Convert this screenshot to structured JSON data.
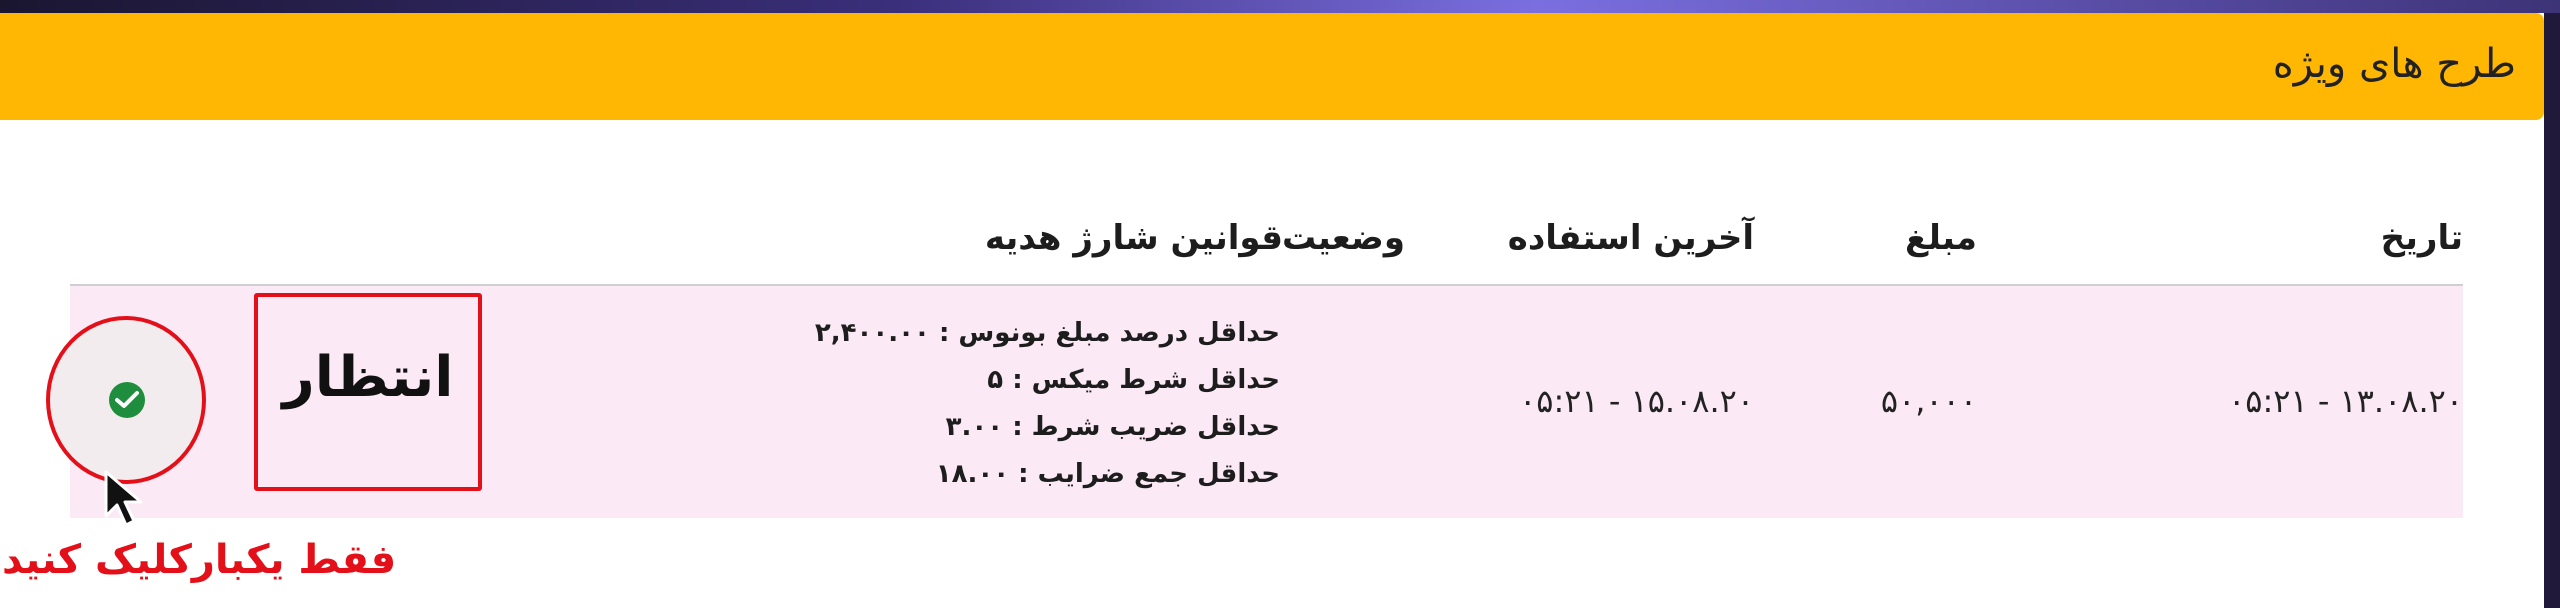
{
  "header": {
    "title": "طرح های ویژه"
  },
  "table": {
    "columns": {
      "date": "تاریخ",
      "amount": "مبلغ",
      "last_used": "آخرین استفاده",
      "rules": "قوانین شارژ هدیه",
      "status": "وضعیت"
    },
    "row": {
      "date": "۱۳.۰۸.۲۰ - ۰۵:۲۱",
      "amount": "۵۰,۰۰۰",
      "last_used": "۱۵.۰۸.۲۰ - ۰۵:۲۱",
      "rules": [
        "حداقل درصد مبلغ بونوس : ۲,۴۰۰.۰۰",
        "حداقل شرط میکس : ۵",
        "حداقل ضریب شرط : ۳.۰۰",
        "حداقل جمع ضرایب : ۱۸.۰۰"
      ],
      "status": "انتظار"
    }
  },
  "annotation": {
    "note": "فقط یکبارکلیک کنید",
    "highlight_color": "#e3101a"
  },
  "colors": {
    "header_bg": "#ffb703",
    "row_bg": "#fbeaf6",
    "check_green": "#1e8e3e"
  },
  "icons": {
    "confirm": "check-circle-icon",
    "pointer": "mouse-pointer-icon"
  }
}
